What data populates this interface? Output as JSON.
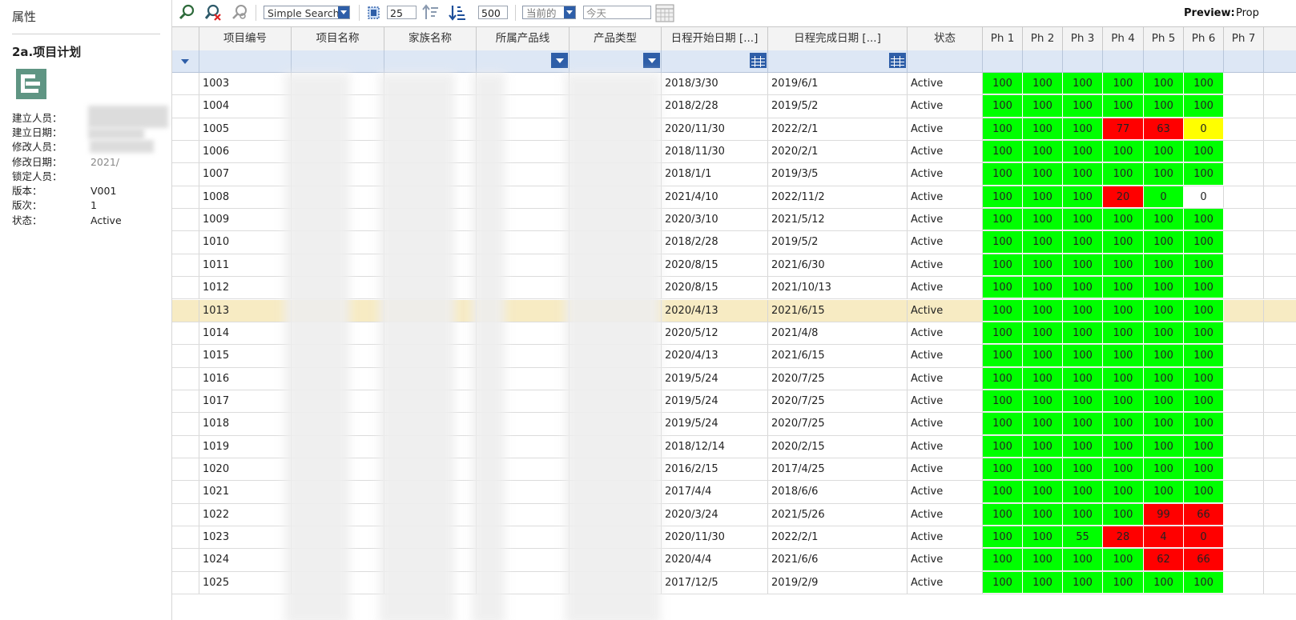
{
  "left_panel": {
    "title": "属性",
    "object_name": "2a.项目计划",
    "properties": [
      {
        "label": "建立人员：",
        "value": ""
      },
      {
        "label": "建立日期：",
        "value": ""
      },
      {
        "label": "修改人员：",
        "value": ""
      },
      {
        "label": "修改日期：",
        "value": "2021/"
      },
      {
        "label": "锁定人员：",
        "value": ""
      },
      {
        "label": "版本：",
        "value": "V001"
      },
      {
        "label": "版次：",
        "value": "1"
      },
      {
        "label": "状态：",
        "value": "Active"
      }
    ]
  },
  "toolbar": {
    "search_mode": "Simple Search",
    "page_size": "25",
    "max_rows": "500",
    "revision_filter": "当前的",
    "date_placeholder": "今天",
    "preview_label": "Preview:",
    "preview_value": "Prop"
  },
  "grid": {
    "columns": [
      "项目编号",
      "项目名称",
      "家族名称",
      "所属产品线",
      "产品类型",
      "日程开始日期 [...]",
      "日程完成日期 [...]",
      "状态",
      "Ph 1",
      "Ph 2",
      "Ph 3",
      "Ph 4",
      "Ph 5",
      "Ph 6",
      "Ph 7"
    ],
    "selected_row_index": 10,
    "rows": [
      {
        "id": "1003",
        "start": "2018/3/30",
        "end": "2019/6/1",
        "status": "Active",
        "ph": [
          100,
          100,
          100,
          100,
          100,
          100
        ]
      },
      {
        "id": "1004",
        "start": "2018/2/28",
        "end": "2019/5/2",
        "status": "Active",
        "ph": [
          100,
          100,
          100,
          100,
          100,
          100
        ]
      },
      {
        "id": "1005",
        "start": "2020/11/30",
        "end": "2022/2/1",
        "status": "Active",
        "ph": [
          100,
          100,
          100,
          77,
          63,
          0
        ]
      },
      {
        "id": "1006",
        "start": "2018/11/30",
        "end": "2020/2/1",
        "status": "Active",
        "ph": [
          100,
          100,
          100,
          100,
          100,
          100
        ]
      },
      {
        "id": "1007",
        "start": "2018/1/1",
        "end": "2019/3/5",
        "status": "Active",
        "ph": [
          100,
          100,
          100,
          100,
          100,
          100
        ]
      },
      {
        "id": "1008",
        "start": "2021/4/10",
        "end": "2022/11/2",
        "status": "Active",
        "ph": [
          100,
          100,
          100,
          20,
          0,
          0
        ]
      },
      {
        "id": "1009",
        "start": "2020/3/10",
        "end": "2021/5/12",
        "status": "Active",
        "ph": [
          100,
          100,
          100,
          100,
          100,
          100
        ]
      },
      {
        "id": "1010",
        "start": "2018/2/28",
        "end": "2019/5/2",
        "status": "Active",
        "ph": [
          100,
          100,
          100,
          100,
          100,
          100
        ]
      },
      {
        "id": "1011",
        "start": "2020/8/15",
        "end": "2021/6/30",
        "status": "Active",
        "ph": [
          100,
          100,
          100,
          100,
          100,
          100
        ]
      },
      {
        "id": "1012",
        "start": "2020/8/15",
        "end": "2021/10/13",
        "status": "Active",
        "ph": [
          100,
          100,
          100,
          100,
          100,
          100
        ]
      },
      {
        "id": "1013",
        "start": "2020/4/13",
        "end": "2021/6/15",
        "status": "Active",
        "ph": [
          100,
          100,
          100,
          100,
          100,
          100
        ]
      },
      {
        "id": "1014",
        "start": "2020/5/12",
        "end": "2021/4/8",
        "status": "Active",
        "ph": [
          100,
          100,
          100,
          100,
          100,
          100
        ]
      },
      {
        "id": "1015",
        "start": "2020/4/13",
        "end": "2021/6/15",
        "status": "Active",
        "ph": [
          100,
          100,
          100,
          100,
          100,
          100
        ]
      },
      {
        "id": "1016",
        "start": "2019/5/24",
        "end": "2020/7/25",
        "status": "Active",
        "ph": [
          100,
          100,
          100,
          100,
          100,
          100
        ]
      },
      {
        "id": "1017",
        "start": "2019/5/24",
        "end": "2020/7/25",
        "status": "Active",
        "ph": [
          100,
          100,
          100,
          100,
          100,
          100
        ]
      },
      {
        "id": "1018",
        "start": "2019/5/24",
        "end": "2020/7/25",
        "status": "Active",
        "ph": [
          100,
          100,
          100,
          100,
          100,
          100
        ]
      },
      {
        "id": "1019",
        "start": "2018/12/14",
        "end": "2020/2/15",
        "status": "Active",
        "ph": [
          100,
          100,
          100,
          100,
          100,
          100
        ]
      },
      {
        "id": "1020",
        "start": "2016/2/15",
        "end": "2017/4/25",
        "status": "Active",
        "ph": [
          100,
          100,
          100,
          100,
          100,
          100
        ]
      },
      {
        "id": "1021",
        "start": "2017/4/4",
        "end": "2018/6/6",
        "status": "Active",
        "ph": [
          100,
          100,
          100,
          100,
          100,
          100
        ]
      },
      {
        "id": "1022",
        "start": "2020/3/24",
        "end": "2021/5/26",
        "status": "Active",
        "ph": [
          100,
          100,
          100,
          100,
          99,
          66
        ]
      },
      {
        "id": "1023",
        "start": "2020/11/30",
        "end": "2022/2/1",
        "status": "Active",
        "ph": [
          100,
          100,
          55,
          28,
          4,
          0
        ]
      },
      {
        "id": "1024",
        "start": "2020/4/4",
        "end": "2021/6/6",
        "status": "Active",
        "ph": [
          100,
          100,
          100,
          100,
          62,
          66
        ]
      },
      {
        "id": "1025",
        "start": "2017/12/5",
        "end": "2019/2/9",
        "status": "Active",
        "ph": [
          100,
          100,
          100,
          100,
          100,
          100
        ]
      }
    ],
    "ph_colors": [
      [
        "green",
        "green",
        "green",
        "green",
        "green",
        "green"
      ],
      [
        "green",
        "green",
        "green",
        "green",
        "green",
        "green"
      ],
      [
        "green",
        "green",
        "green",
        "red",
        "red",
        "yellow"
      ],
      [
        "green",
        "green",
        "green",
        "green",
        "green",
        "green"
      ],
      [
        "green",
        "green",
        "green",
        "green",
        "green",
        "green"
      ],
      [
        "green",
        "green",
        "green",
        "red",
        "green",
        "white"
      ],
      [
        "green",
        "green",
        "green",
        "green",
        "green",
        "green"
      ],
      [
        "green",
        "green",
        "green",
        "green",
        "green",
        "green"
      ],
      [
        "green",
        "green",
        "green",
        "green",
        "green",
        "green"
      ],
      [
        "green",
        "green",
        "green",
        "green",
        "green",
        "green"
      ],
      [
        "green",
        "green",
        "green",
        "green",
        "green",
        "green"
      ],
      [
        "green",
        "green",
        "green",
        "green",
        "green",
        "green"
      ],
      [
        "green",
        "green",
        "green",
        "green",
        "green",
        "green"
      ],
      [
        "green",
        "green",
        "green",
        "green",
        "green",
        "green"
      ],
      [
        "green",
        "green",
        "green",
        "green",
        "green",
        "green"
      ],
      [
        "green",
        "green",
        "green",
        "green",
        "green",
        "green"
      ],
      [
        "green",
        "green",
        "green",
        "green",
        "green",
        "green"
      ],
      [
        "green",
        "green",
        "green",
        "green",
        "green",
        "green"
      ],
      [
        "green",
        "green",
        "green",
        "green",
        "green",
        "green"
      ],
      [
        "green",
        "green",
        "green",
        "green",
        "red",
        "red"
      ],
      [
        "green",
        "green",
        "green",
        "red",
        "red",
        "red"
      ],
      [
        "green",
        "green",
        "green",
        "green",
        "red",
        "red"
      ],
      [
        "green",
        "green",
        "green",
        "green",
        "green",
        "green"
      ]
    ]
  },
  "colors": {
    "green": "#00ff00",
    "red": "#ff0000",
    "yellow": "#ffff00",
    "selected_row": "#f7ebc3",
    "filter_row": "#dde7f5",
    "accent": "#2e5ea8"
  }
}
